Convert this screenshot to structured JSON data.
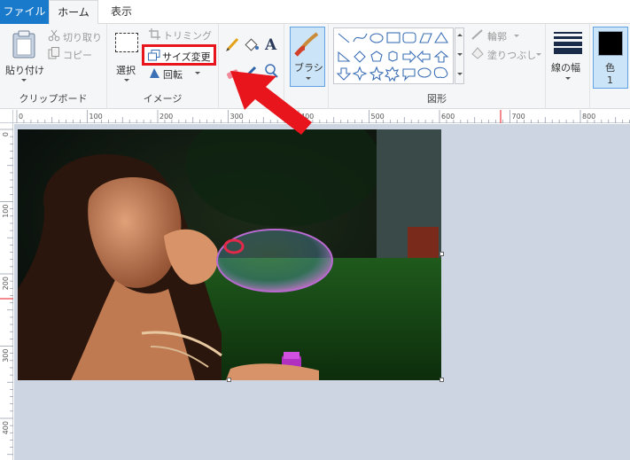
{
  "tabs": {
    "file": "ファイル",
    "home": "ホーム",
    "view": "表示"
  },
  "clipboard": {
    "paste": "貼り付け",
    "cut": "切り取り",
    "copy": "コピー",
    "group_label": "クリップボード"
  },
  "image_group": {
    "select": "選択",
    "crop": "トリミング",
    "resize": "サイズ変更",
    "rotate": "回転",
    "group_label": "イメージ"
  },
  "brushes": {
    "label": "ブラシ"
  },
  "shapes": {
    "outline": "輪郭",
    "fill": "塗りつぶし",
    "group_label": "図形"
  },
  "size": {
    "label": "線の幅"
  },
  "color1": {
    "label": "色",
    "number": "1"
  },
  "ruler": {
    "h_ticks": [
      "0",
      "100",
      "200",
      "300",
      "400",
      "500",
      "600",
      "700",
      "800"
    ],
    "v_ticks": [
      "0",
      "100",
      "200",
      "300",
      "400"
    ]
  },
  "colors": {
    "file_tab": "#1979ca",
    "highlight": "#e8151d",
    "arrow": "#e8151d",
    "canvas_bg": "#cdd5e2",
    "color1": "#000000"
  }
}
